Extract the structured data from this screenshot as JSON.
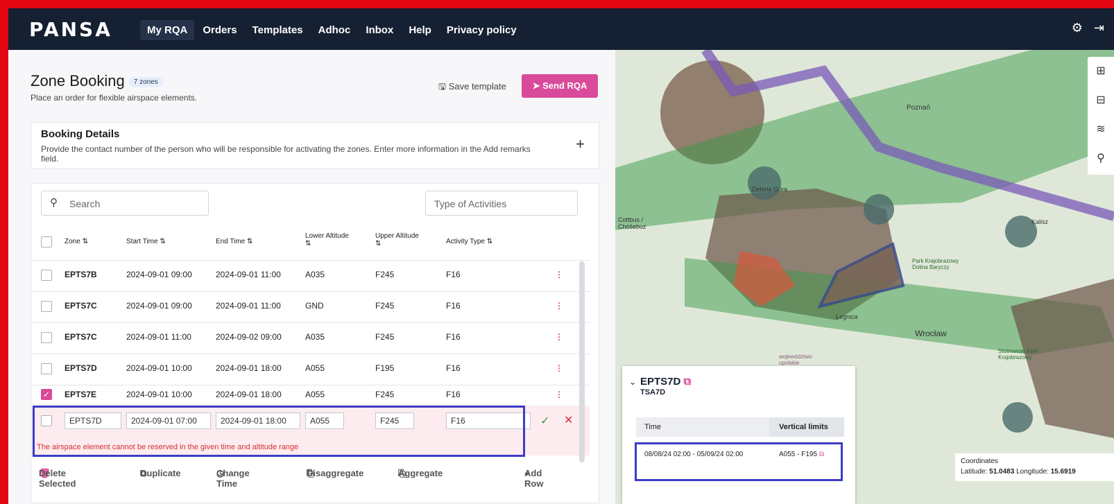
{
  "app": {
    "logo": "PANSA"
  },
  "nav": {
    "items": [
      "My RQA",
      "Orders",
      "Templates",
      "Adhoc",
      "Inbox",
      "Help",
      "Privacy policy"
    ],
    "active": "My RQA"
  },
  "topbar": {
    "icons": [
      "gear-icon",
      "logout-icon"
    ]
  },
  "page": {
    "title": "Zone Booking",
    "badge": "7 zones",
    "subtitle": "Place an order for flexible airspace elements.",
    "save_template": "Save template",
    "send_rqa": "Send RQA"
  },
  "details": {
    "title": "Booking Details",
    "description": "Provide the contact number of the person who will be responsible for activating the zones. Enter more information in the Add remarks field."
  },
  "filters": {
    "search_placeholder": "Search",
    "activity_placeholder": "Type of Activities"
  },
  "table": {
    "headers": [
      "Zone",
      "Start Time",
      "End Time",
      "Lower Altitude",
      "Upper Altitude",
      "Activity Type"
    ],
    "rows": [
      {
        "zone": "EPTS7B",
        "start": "2024-09-01 09:00",
        "end": "2024-09-01 11:00",
        "lower": "A035",
        "upper": "F245",
        "activity": "F16",
        "checked": false
      },
      {
        "zone": "EPTS7C",
        "start": "2024-09-01 09:00",
        "end": "2024-09-01 11:00",
        "lower": "GND",
        "upper": "F245",
        "activity": "F16",
        "checked": false
      },
      {
        "zone": "EPTS7C",
        "start": "2024-09-01 11:00",
        "end": "2024-09-02 09:00",
        "lower": "A035",
        "upper": "F245",
        "activity": "F16",
        "checked": false
      },
      {
        "zone": "EPTS7D",
        "start": "2024-09-01 10:00",
        "end": "2024-09-01 18:00",
        "lower": "A055",
        "upper": "F195",
        "activity": "F16",
        "checked": false
      },
      {
        "zone": "EPTS7E",
        "start": "2024-09-01 10:00",
        "end": "2024-09-01 18:00",
        "lower": "A055",
        "upper": "F245",
        "activity": "F16",
        "checked": true
      }
    ],
    "edit_row": {
      "zone": "EPTS7D",
      "start": "2024-09-01 07:00",
      "end": "2024-09-01 18:00",
      "lower": "A055",
      "upper": "F245",
      "activity": "F16"
    },
    "error": "The airspace element cannot be reserved in the given time and altitude range"
  },
  "actions": [
    "Delete Selected",
    "Duplicate",
    "Change Time",
    "Disaggregate",
    "Aggregate",
    "Add Row"
  ],
  "map": {
    "labels": [
      "Poznań",
      "Zielona Góra",
      "Cottbus / Chóšebuz",
      "Legnica",
      "Wrocław",
      "Kalisz",
      "Park Krajobrazowy Dolina Baryczy",
      "Stobrawski Park Krajobrazowy",
      "województwo opolskie"
    ],
    "popup": {
      "title": "EPTS7D",
      "subtitle": "TSA7D",
      "col_time": "Time",
      "col_limits": "Vertical limits",
      "time": "08/08/24 02:00 - 05/09/24 02:00",
      "limits": "A055 - F195"
    },
    "coords": {
      "label": "Coordinates",
      "latitude_label": "Latitude:",
      "latitude": "51.0483",
      "longitude_label": "Longitude:",
      "longitude": "15.6919"
    }
  }
}
